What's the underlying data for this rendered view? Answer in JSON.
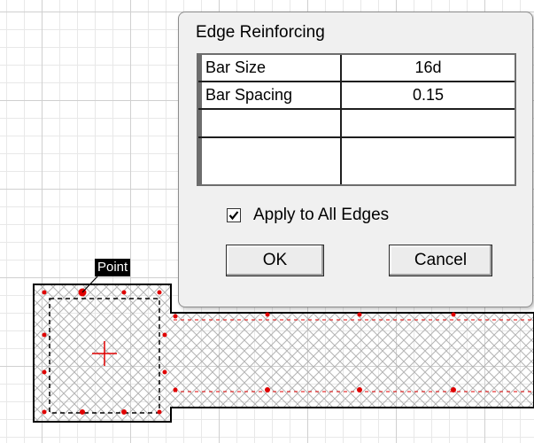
{
  "canvas": {
    "point_label": "Point",
    "colors": {
      "grid": "#d0d0d0",
      "outline": "#000000",
      "reinforcing": "#e00000",
      "hatch": "#b4b4b4"
    }
  },
  "dialog": {
    "title": "Edge Reinforcing",
    "rows": [
      {
        "name": "Bar Size",
        "value": "16d"
      },
      {
        "name": "Bar Spacing",
        "value": "0.15"
      },
      {
        "name": "",
        "value": ""
      },
      {
        "name": "",
        "value": ""
      }
    ],
    "apply_all": {
      "label": "Apply to All Edges",
      "checked": true
    },
    "ok_label": "OK",
    "cancel_label": "Cancel"
  }
}
